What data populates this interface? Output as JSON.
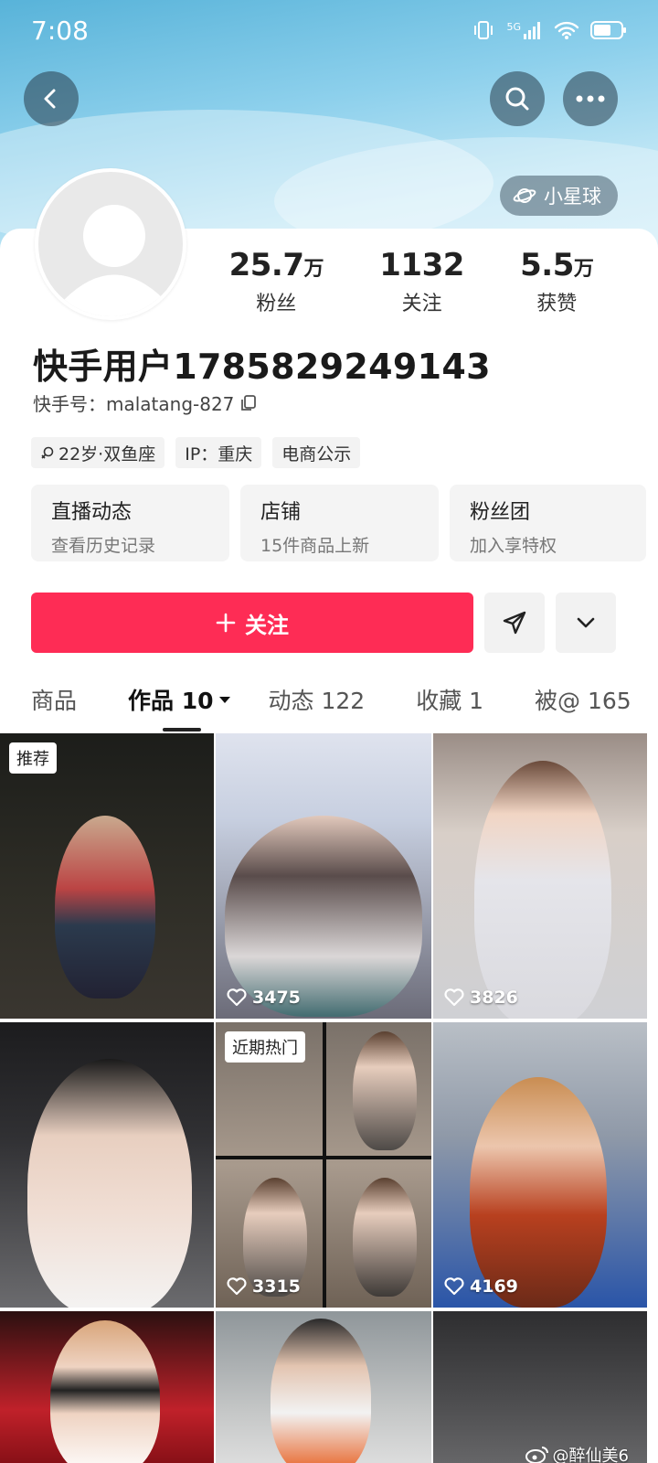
{
  "status_bar": {
    "time": "7:08",
    "network": "5G"
  },
  "profile": {
    "planet_badge": "小星球",
    "stats": [
      {
        "num": "25.7",
        "unit": "万",
        "label": "粉丝"
      },
      {
        "num": "1132",
        "unit": "",
        "label": "关注"
      },
      {
        "num": "5.5",
        "unit": "万",
        "label": "获赞"
      }
    ],
    "username": "快手用户1785829249143",
    "user_id": "快手号：malatang-827",
    "tags": [
      "22岁·双鱼座",
      "IP：重庆",
      "电商公示"
    ],
    "cards": [
      {
        "title": "直播动态",
        "sub": "查看历史记录"
      },
      {
        "title": "店铺",
        "sub": "15件商品上新"
      },
      {
        "title": "粉丝团",
        "sub": "加入享特权"
      }
    ],
    "follow_label": "关注"
  },
  "tabs": [
    {
      "label": "商品"
    },
    {
      "label": "作品 10"
    },
    {
      "label": "动态 122"
    },
    {
      "label": "收藏 1"
    },
    {
      "label": "被@ 165"
    }
  ],
  "videos": [
    {
      "badge": "推荐",
      "likes": ""
    },
    {
      "badge": "",
      "likes": "3475"
    },
    {
      "badge": "",
      "likes": "3826"
    },
    {
      "badge": "",
      "likes": ""
    },
    {
      "badge": "近期热门",
      "likes": "3315"
    },
    {
      "badge": "",
      "likes": "4169"
    }
  ],
  "watermark": "@醉仙美6",
  "colors": {
    "accent": "#fe2c55",
    "banner": "#8dd0ec"
  }
}
